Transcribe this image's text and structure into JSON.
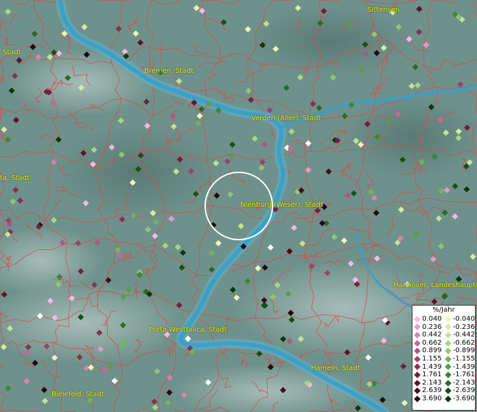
{
  "map": {
    "labels": [
      {
        "key": "sittensen",
        "text": "Sittensen"
      },
      {
        "key": "stadt-left-top",
        "text": "Stadt"
      },
      {
        "key": "bremen",
        "text": "Bremen, Stadt"
      },
      {
        "key": "verden",
        "text": "Verden (Aller), Stadt"
      },
      {
        "key": "ta-stadt",
        "text": "ta, Stadt"
      },
      {
        "key": "nienburg",
        "text": "Nienburg (Weser), Stadt"
      },
      {
        "key": "hannover",
        "text": "Hannover, Landeshaupts"
      },
      {
        "key": "porta",
        "text": "Porta Westfalica, Stadt"
      },
      {
        "key": "hameln",
        "text": "Hameln, Stadt"
      },
      {
        "key": "bielefeld",
        "text": "Bielefeld, Stadt"
      }
    ],
    "colors": {
      "terrain": "#6f918b",
      "river": "#3aa0c8",
      "borders": "#d84a4a",
      "label_text": "#f4f000",
      "focus_circle": "#ffffff"
    }
  },
  "legend": {
    "title": "%/Jahr",
    "rows": [
      {
        "pos": "0.040",
        "pos_color": "#f7b8e8",
        "neg": "-0.040",
        "neg_color": "#eef8b8"
      },
      {
        "pos": "0.236",
        "pos_color": "#e79ac8",
        "neg": "-0.236",
        "neg_color": "#d6eea4"
      },
      {
        "pos": "0.442",
        "pos_color": "#d784ae",
        "neg": "-0.442",
        "neg_color": "#c0e496"
      },
      {
        "pos": "0.662",
        "pos_color": "#c46a96",
        "neg": "-0.662",
        "neg_color": "#a6d884"
      },
      {
        "pos": "0.899",
        "pos_color": "#b0567e",
        "neg": "-0.899",
        "neg_color": "#8ec872"
      },
      {
        "pos": "1.155",
        "pos_color": "#9c4268",
        "neg": "-1.155",
        "neg_color": "#72b45c"
      },
      {
        "pos": "1.439",
        "pos_color": "#863052",
        "neg": "-1.439",
        "neg_color": "#589e48"
      },
      {
        "pos": "1.761",
        "pos_color": "#70203e",
        "neg": "-1.761",
        "neg_color": "#3e8436"
      },
      {
        "pos": "2.143",
        "pos_color": "#58142c",
        "neg": "-2.143",
        "neg_color": "#2a6a26"
      },
      {
        "pos": "2.639",
        "pos_color": "#400a1c",
        "neg": "-2.639",
        "neg_color": "#165016"
      },
      {
        "pos": "3.690",
        "pos_color": "#24040e",
        "neg": "-3.690",
        "neg_color": "#083808"
      }
    ]
  }
}
